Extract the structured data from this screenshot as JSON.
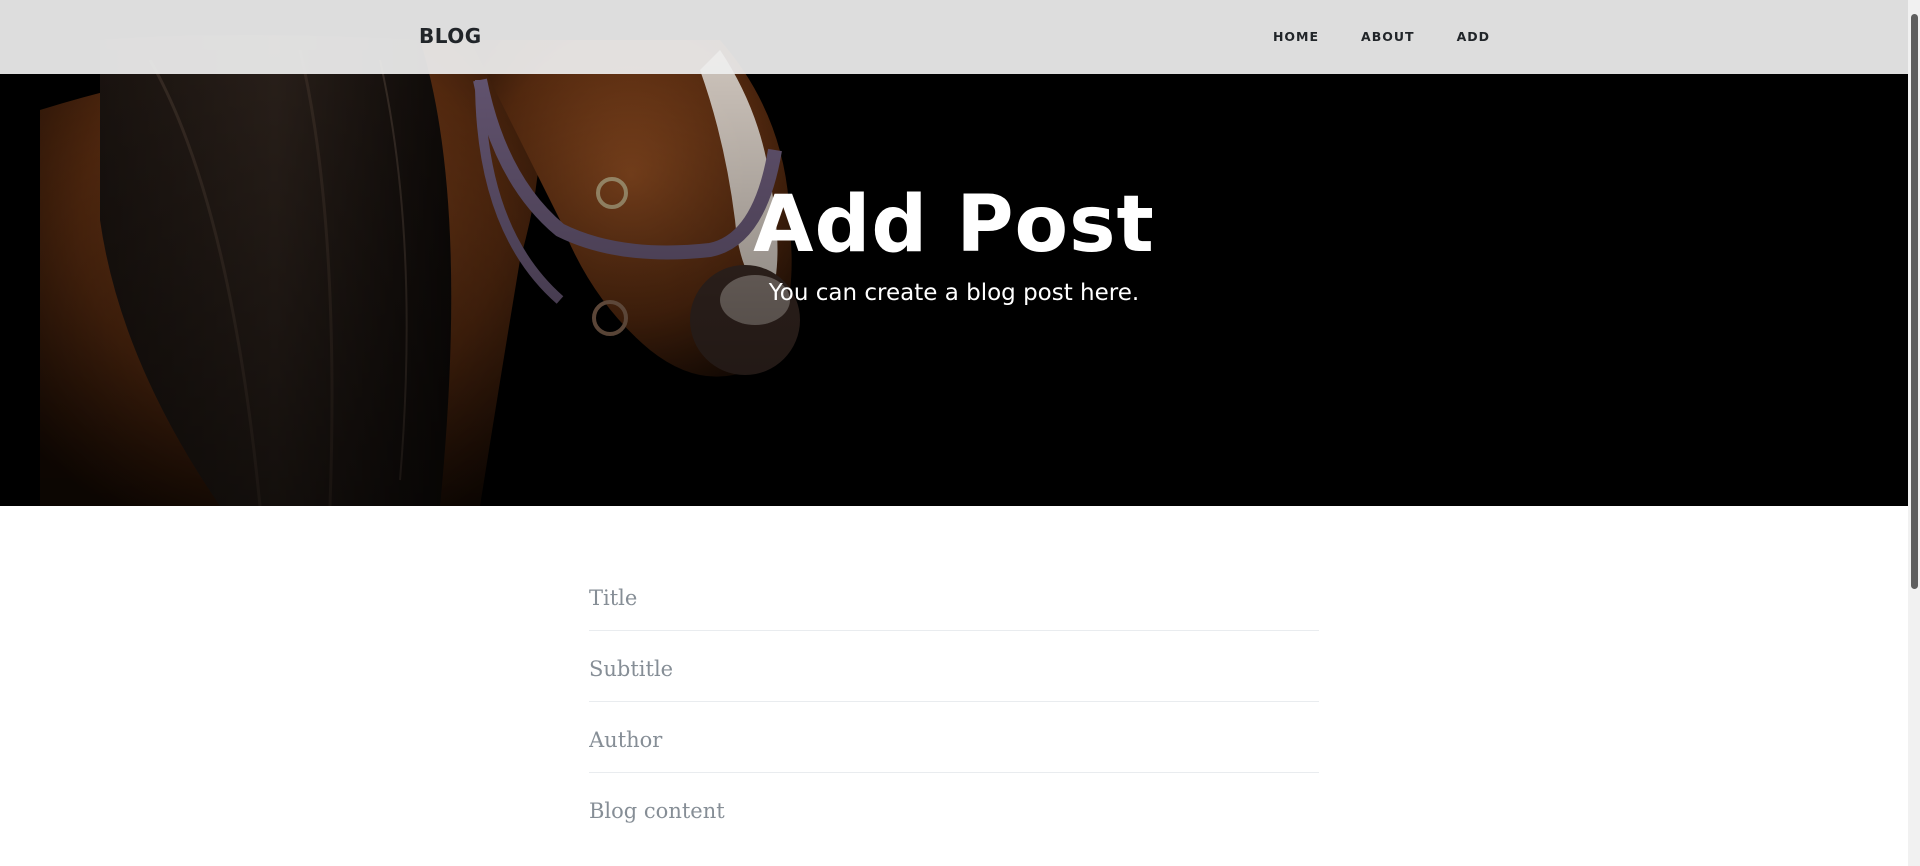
{
  "navbar": {
    "brand": "BLOG",
    "links": [
      "HOME",
      "ABOUT",
      "ADD"
    ]
  },
  "hero": {
    "title": "Add Post",
    "subtitle": "You can create a blog post here.",
    "background_image": "horse-photo"
  },
  "form": {
    "fields": [
      {
        "placeholder": "Title",
        "value": ""
      },
      {
        "placeholder": "Subtitle",
        "value": ""
      },
      {
        "placeholder": "Author",
        "value": ""
      },
      {
        "placeholder": "Blog content",
        "value": ""
      }
    ]
  },
  "colors": {
    "navbar_bg": "#eeeeee",
    "hero_bg": "#000000",
    "placeholder": "#868e96",
    "text_dark": "#212529"
  }
}
